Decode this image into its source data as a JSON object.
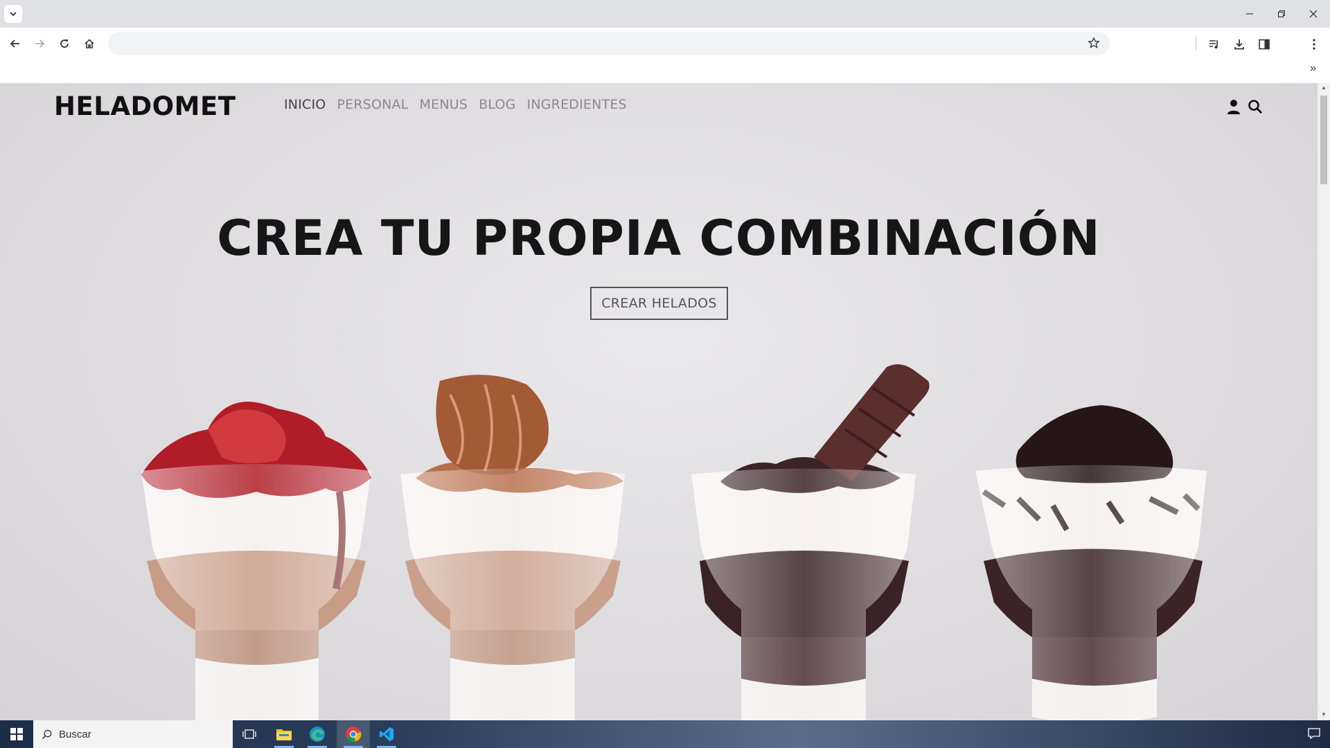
{
  "browser": {
    "address_placeholder": ""
  },
  "site": {
    "logo": "HELADOMET",
    "nav": [
      {
        "label": "INICIO",
        "active": true
      },
      {
        "label": "PERSONAL",
        "active": false
      },
      {
        "label": "MENUS",
        "active": false
      },
      {
        "label": "BLOG",
        "active": false
      },
      {
        "label": "INGREDIENTES",
        "active": false
      }
    ],
    "hero_title": "CREA TU PROPIA COMBINACIÓN",
    "cta_label": "CREAR HELADOS"
  },
  "taskbar": {
    "search_placeholder": "Buscar",
    "apps": [
      "task-view-icon",
      "file-explorer-icon",
      "edge-icon",
      "chrome-icon",
      "vscode-icon"
    ]
  },
  "colors": {
    "accent": "#161616",
    "nav_inactive": "#8a8a8a",
    "nav_active": "#444444"
  }
}
